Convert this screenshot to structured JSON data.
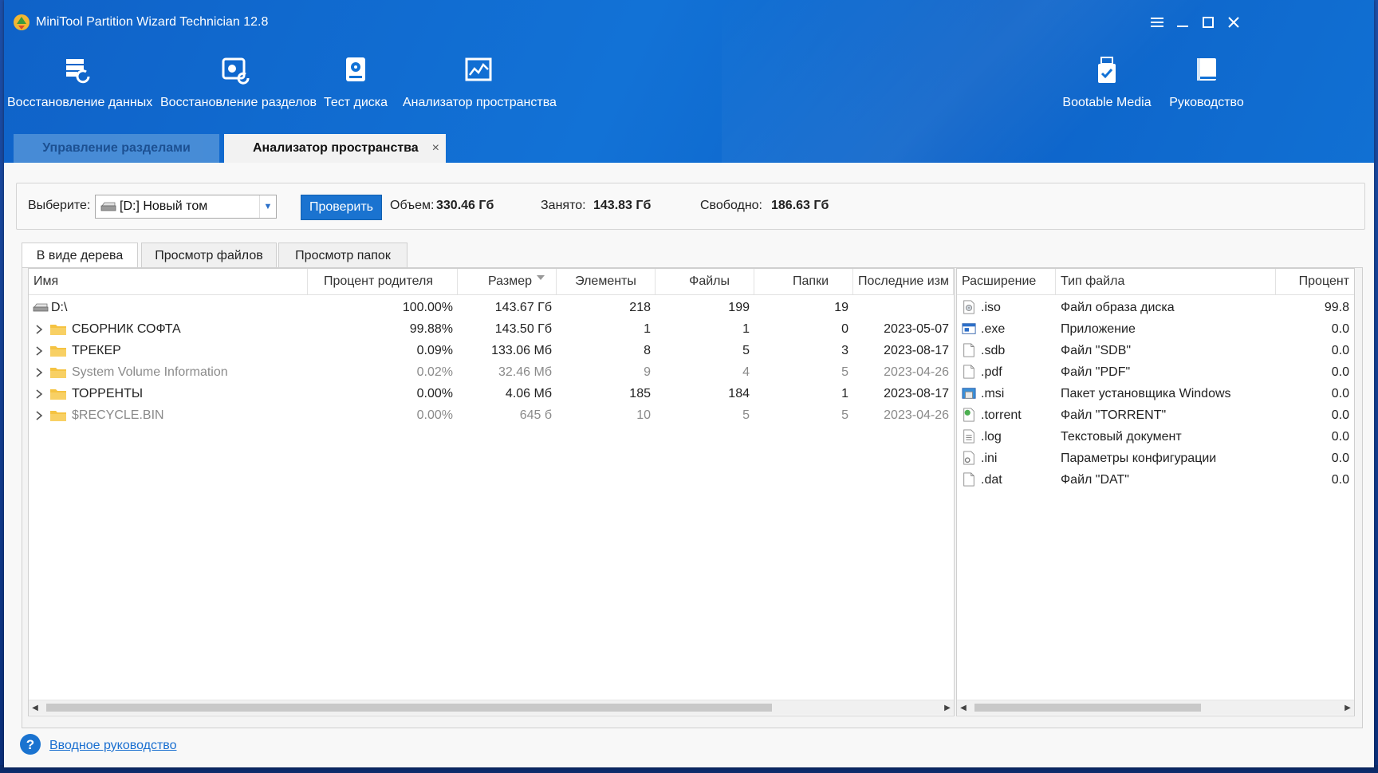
{
  "window": {
    "title": "MiniTool Partition Wizard Technician 12.8"
  },
  "toolbar": {
    "items": [
      {
        "label": "Восстановление данных",
        "icon": "data-recovery-icon"
      },
      {
        "label": "Восстановление разделов",
        "icon": "partition-recovery-icon"
      },
      {
        "label": "Тест диска",
        "icon": "disk-benchmark-icon"
      },
      {
        "label": "Анализатор пространства",
        "icon": "space-analyzer-icon"
      },
      {
        "label": "Bootable Media",
        "icon": "bootable-media-icon"
      },
      {
        "label": "Руководство",
        "icon": "manual-icon"
      }
    ]
  },
  "main_tabs": [
    {
      "label": "Управление разделами",
      "active": false
    },
    {
      "label": "Анализатор пространства",
      "active": true,
      "close": "×"
    }
  ],
  "selector": {
    "label": "Выберите:",
    "drive": "[D:] Новый том",
    "scan_button": "Проверить",
    "total_label": "Объем:",
    "total_value": "330.46 Гб",
    "used_label": "Занято:",
    "used_value": "143.83 Гб",
    "free_label": "Свободно:",
    "free_value": "186.63 Гб"
  },
  "view_tabs": [
    {
      "label": "В виде дерева",
      "active": true
    },
    {
      "label": "Просмотр файлов",
      "active": false
    },
    {
      "label": "Просмотр папок",
      "active": false
    }
  ],
  "tree": {
    "columns": [
      "Имя",
      "Процент родителя",
      "Размер",
      "Элементы",
      "Файлы",
      "Папки",
      "Последние изм"
    ],
    "rows": [
      {
        "name": "D:\\",
        "percent": "100.00%",
        "size": "143.67 Гб",
        "items": "218",
        "files": "199",
        "folders": "19",
        "modified": "",
        "type": "drive",
        "dim": false
      },
      {
        "name": "СБОРНИК СОФТА",
        "percent": "99.88%",
        "size": "143.50 Гб",
        "items": "1",
        "files": "1",
        "folders": "0",
        "modified": "2023-05-07",
        "type": "folder",
        "dim": false
      },
      {
        "name": "ТРЕКЕР",
        "percent": "0.09%",
        "size": "133.06 Мб",
        "items": "8",
        "files": "5",
        "folders": "3",
        "modified": "2023-08-17",
        "type": "folder",
        "dim": false
      },
      {
        "name": "System Volume Information",
        "percent": "0.02%",
        "size": "32.46 Мб",
        "items": "9",
        "files": "4",
        "folders": "5",
        "modified": "2023-04-26",
        "type": "folder",
        "dim": true
      },
      {
        "name": "ТОРРЕНТЫ",
        "percent": "0.00%",
        "size": "4.06 Мб",
        "items": "185",
        "files": "184",
        "folders": "1",
        "modified": "2023-08-17",
        "type": "folder",
        "dim": false
      },
      {
        "name": "$RECYCLE.BIN",
        "percent": "0.00%",
        "size": "645 б",
        "items": "10",
        "files": "5",
        "folders": "5",
        "modified": "2023-04-26",
        "type": "folder",
        "dim": true
      }
    ]
  },
  "ext_table": {
    "columns": [
      "Расширение",
      "Тип файла",
      "Процент"
    ],
    "rows": [
      {
        "ext": ".iso",
        "type": "Файл образа диска",
        "percent": "99.8",
        "icon": "disc-image-icon"
      },
      {
        "ext": ".exe",
        "type": "Приложение",
        "percent": "0.0",
        "icon": "application-icon"
      },
      {
        "ext": ".sdb",
        "type": "Файл \"SDB\"",
        "percent": "0.0",
        "icon": "blank-file-icon"
      },
      {
        "ext": ".pdf",
        "type": "Файл \"PDF\"",
        "percent": "0.0",
        "icon": "blank-file-icon"
      },
      {
        "ext": ".msi",
        "type": "Пакет установщика Windows",
        "percent": "0.0",
        "icon": "installer-icon"
      },
      {
        "ext": ".torrent",
        "type": "Файл \"TORRENT\"",
        "percent": "0.0",
        "icon": "torrent-icon"
      },
      {
        "ext": ".log",
        "type": "Текстовый документ",
        "percent": "0.0",
        "icon": "text-file-icon"
      },
      {
        "ext": ".ini",
        "type": "Параметры конфигурации",
        "percent": "0.0",
        "icon": "config-file-icon"
      },
      {
        "ext": ".dat",
        "type": "Файл \"DAT\"",
        "percent": "0.0",
        "icon": "blank-file-icon"
      }
    ]
  },
  "footer": {
    "help_link": "Вводное руководство"
  },
  "colors": {
    "header_blue": "#1272d6",
    "scan_button": "#1a73d0",
    "folder_yellow": "#f5c342",
    "link": "#1a6fd0"
  }
}
